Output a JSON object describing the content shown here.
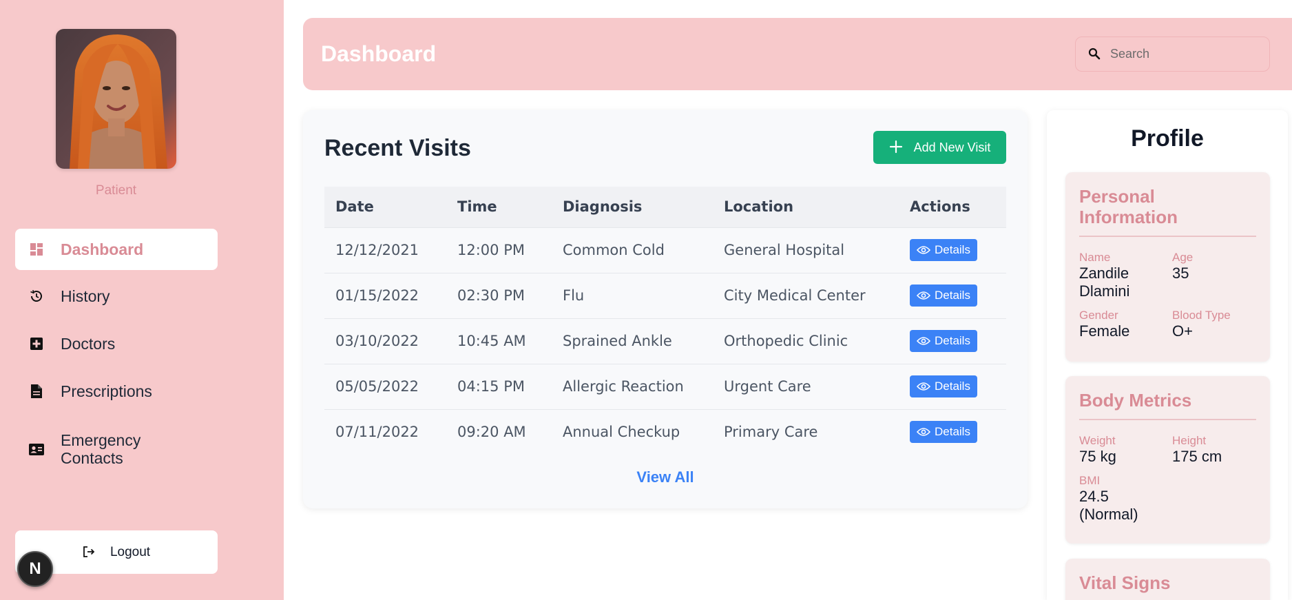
{
  "sidebar": {
    "role": "Patient",
    "nav": [
      {
        "label": "Dashboard",
        "icon": "dashboard-icon",
        "active": true
      },
      {
        "label": "History",
        "icon": "history-icon",
        "active": false
      },
      {
        "label": "Doctors",
        "icon": "medical-plus-icon",
        "active": false
      },
      {
        "label": "Prescriptions",
        "icon": "document-icon",
        "active": false
      },
      {
        "label": "Emergency Contacts",
        "icon": "contact-card-icon",
        "active": false
      }
    ],
    "logout_label": "Logout",
    "badge_letter": "N"
  },
  "header": {
    "title": "Dashboard",
    "search_placeholder": "Search"
  },
  "visits": {
    "title": "Recent Visits",
    "add_label": "Add New Visit",
    "columns": [
      "Date",
      "Time",
      "Diagnosis",
      "Location",
      "Actions"
    ],
    "rows": [
      {
        "date": "12/12/2021",
        "time": "12:00 PM",
        "diagnosis": "Common Cold",
        "location": "General Hospital",
        "action": "Details"
      },
      {
        "date": "01/15/2022",
        "time": "02:30 PM",
        "diagnosis": "Flu",
        "location": "City Medical Center",
        "action": "Details"
      },
      {
        "date": "03/10/2022",
        "time": "10:45 AM",
        "diagnosis": "Sprained Ankle",
        "location": "Orthopedic Clinic",
        "action": "Details"
      },
      {
        "date": "05/05/2022",
        "time": "04:15 PM",
        "diagnosis": "Allergic Reaction",
        "location": "Urgent Care",
        "action": "Details"
      },
      {
        "date": "07/11/2022",
        "time": "09:20 AM",
        "diagnosis": "Annual Checkup",
        "location": "Primary Care",
        "action": "Details"
      }
    ],
    "view_all": "View All"
  },
  "profile": {
    "title": "Profile",
    "personal": {
      "heading": "Personal Information",
      "name_label": "Name",
      "name": "Zandile Dlamini",
      "age_label": "Age",
      "age": "35",
      "gender_label": "Gender",
      "gender": "Female",
      "blood_label": "Blood Type",
      "blood": "O+"
    },
    "metrics": {
      "heading": "Body Metrics",
      "weight_label": "Weight",
      "weight": "75 kg",
      "height_label": "Height",
      "height": "175 cm",
      "bmi_label": "BMI",
      "bmi": "24.5 (Normal)"
    },
    "vitals": {
      "heading": "Vital Signs"
    }
  },
  "colors": {
    "sidebar_bg": "#f7c9cb",
    "accent_pink": "#d98b95",
    "add_button": "#16b07a",
    "details_button": "#3b82f6"
  }
}
